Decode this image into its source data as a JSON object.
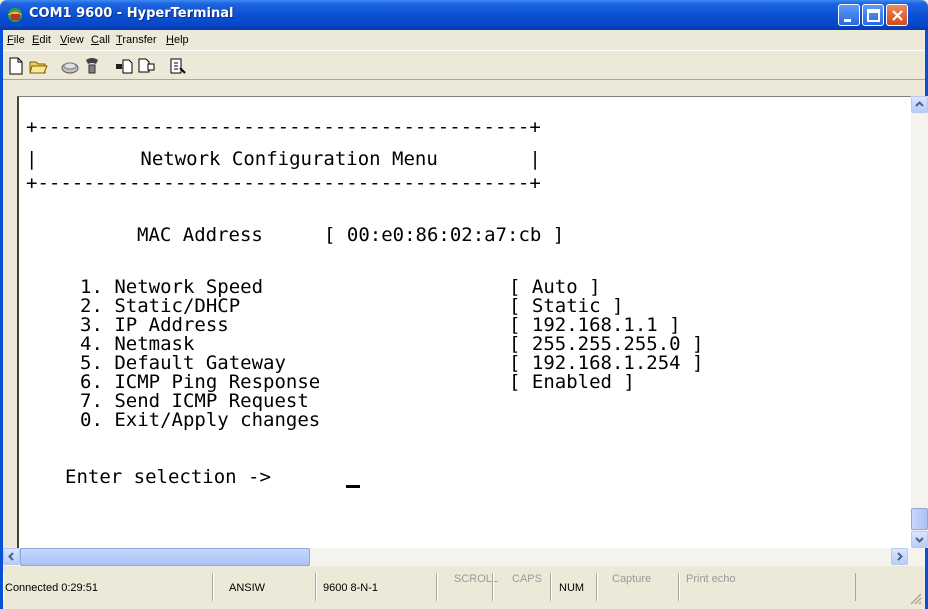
{
  "window": {
    "title": "COM1 9600 - HyperTerminal"
  },
  "menu": {
    "items": [
      {
        "label": "File",
        "underline": "F",
        "rest": "ile"
      },
      {
        "label": "Edit",
        "underline": "E",
        "rest": "dit"
      },
      {
        "label": "View",
        "underline": "V",
        "rest": "iew"
      },
      {
        "label": "Call",
        "underline": "C",
        "rest": "all"
      },
      {
        "label": "Transfer",
        "underline": "T",
        "rest": "ransfer"
      },
      {
        "label": "Help",
        "underline": "H",
        "rest": "elp"
      }
    ]
  },
  "toolbar": {
    "icons": [
      "new-icon",
      "open-icon",
      "connect-icon",
      "disconnect-icon",
      "send-icon",
      "receive-icon",
      "properties-icon"
    ]
  },
  "terminal": {
    "border_top": "+-------------------------------------------+",
    "title_line": "|         Network Configuration Menu        |",
    "border_bottom": "+-------------------------------------------+",
    "mac_label": "MAC Address",
    "mac_value": "[ 00:e0:86:02:a7:cb ]",
    "options": [
      {
        "text": "1. Network Speed",
        "value": "[ Auto ]"
      },
      {
        "text": "2. Static/DHCP",
        "value": "[ Static ]"
      },
      {
        "text": "3. IP Address",
        "value": "[ 192.168.1.1 ]"
      },
      {
        "text": "4. Netmask",
        "value": "[ 255.255.255.0 ]"
      },
      {
        "text": "5. Default Gateway",
        "value": "[ 192.168.1.254 ]"
      },
      {
        "text": "6. ICMP Ping Response",
        "value": "[ Enabled ]"
      },
      {
        "text": "7. Send ICMP Request",
        "value": ""
      },
      {
        "text": "0. Exit/Apply changes",
        "value": ""
      }
    ],
    "prompt": "Enter selection ->"
  },
  "status": {
    "connected": "Connected 0:29:51",
    "emulation": "ANSIW",
    "port_settings": "9600 8-N-1",
    "scroll": "SCROLL",
    "caps": "CAPS",
    "num": "NUM",
    "capture": "Capture",
    "print_echo": "Print echo"
  },
  "colors": {
    "title_bar": "#0a50d4",
    "window_bg": "#ece9d8",
    "terminal_bg": "#ffffff"
  }
}
